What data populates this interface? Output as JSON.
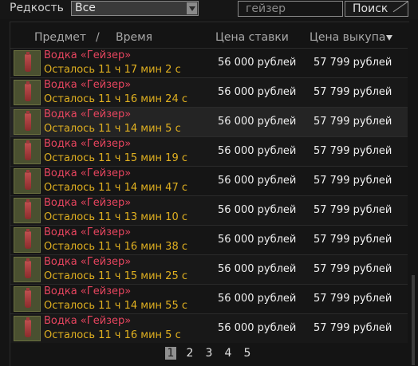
{
  "filter": {
    "rarity_label": "Редкость",
    "rarity_value": "Все"
  },
  "search": {
    "placeholder": "гейзер",
    "button_label": "Поиск"
  },
  "table": {
    "headers": {
      "item": "Предмет",
      "separator": "/",
      "time": "Время",
      "bid": "Цена ставки",
      "buyout": "Цена выкупа"
    },
    "sort_icon": "triangle-down-icon",
    "rows": [
      {
        "name": "Водка «Гейзер»",
        "time_left": "Осталось 11 ч 17 мин 2 с",
        "bid": "56 000 рублей",
        "buyout": "57 799 рублей"
      },
      {
        "name": "Водка «Гейзер»",
        "time_left": "Осталось 11 ч 16 мин 24 с",
        "bid": "56 000 рублей",
        "buyout": "57 799 рублей"
      },
      {
        "name": "Водка «Гейзер»",
        "time_left": "Осталось 11 ч 14 мин 5 с",
        "bid": "56 000 рублей",
        "buyout": "57 799 рублей"
      },
      {
        "name": "Водка «Гейзер»",
        "time_left": "Осталось 11 ч 15 мин 19 с",
        "bid": "56 000 рублей",
        "buyout": "57 799 рублей"
      },
      {
        "name": "Водка «Гейзер»",
        "time_left": "Осталось 11 ч 14 мин 47 с",
        "bid": "56 000 рублей",
        "buyout": "57 799 рублей"
      },
      {
        "name": "Водка «Гейзер»",
        "time_left": "Осталось 11 ч 13 мин 10 с",
        "bid": "56 000 рублей",
        "buyout": "57 799 рублей"
      },
      {
        "name": "Водка «Гейзер»",
        "time_left": "Осталось 11 ч 16 мин 38 с",
        "bid": "56 000 рублей",
        "buyout": "57 799 рублей"
      },
      {
        "name": "Водка «Гейзер»",
        "time_left": "Осталось 11 ч 15 мин 25 с",
        "bid": "56 000 рублей",
        "buyout": "57 799 рублей"
      },
      {
        "name": "Водка «Гейзер»",
        "time_left": "Осталось 11 ч 14 мин 55 с",
        "bid": "56 000 рублей",
        "buyout": "57 799 рублей"
      },
      {
        "name": "Водка «Гейзер»",
        "time_left": "Осталось 11 ч 16 мин 5 с",
        "bid": "56 000 рублей",
        "buyout": "57 799 рублей"
      }
    ]
  },
  "pagination": {
    "pages": [
      "1",
      "2",
      "3",
      "4",
      "5"
    ],
    "current": "1"
  },
  "colors": {
    "item_name": "#e8455f",
    "time_left": "#e0b020",
    "background": "#141414"
  }
}
